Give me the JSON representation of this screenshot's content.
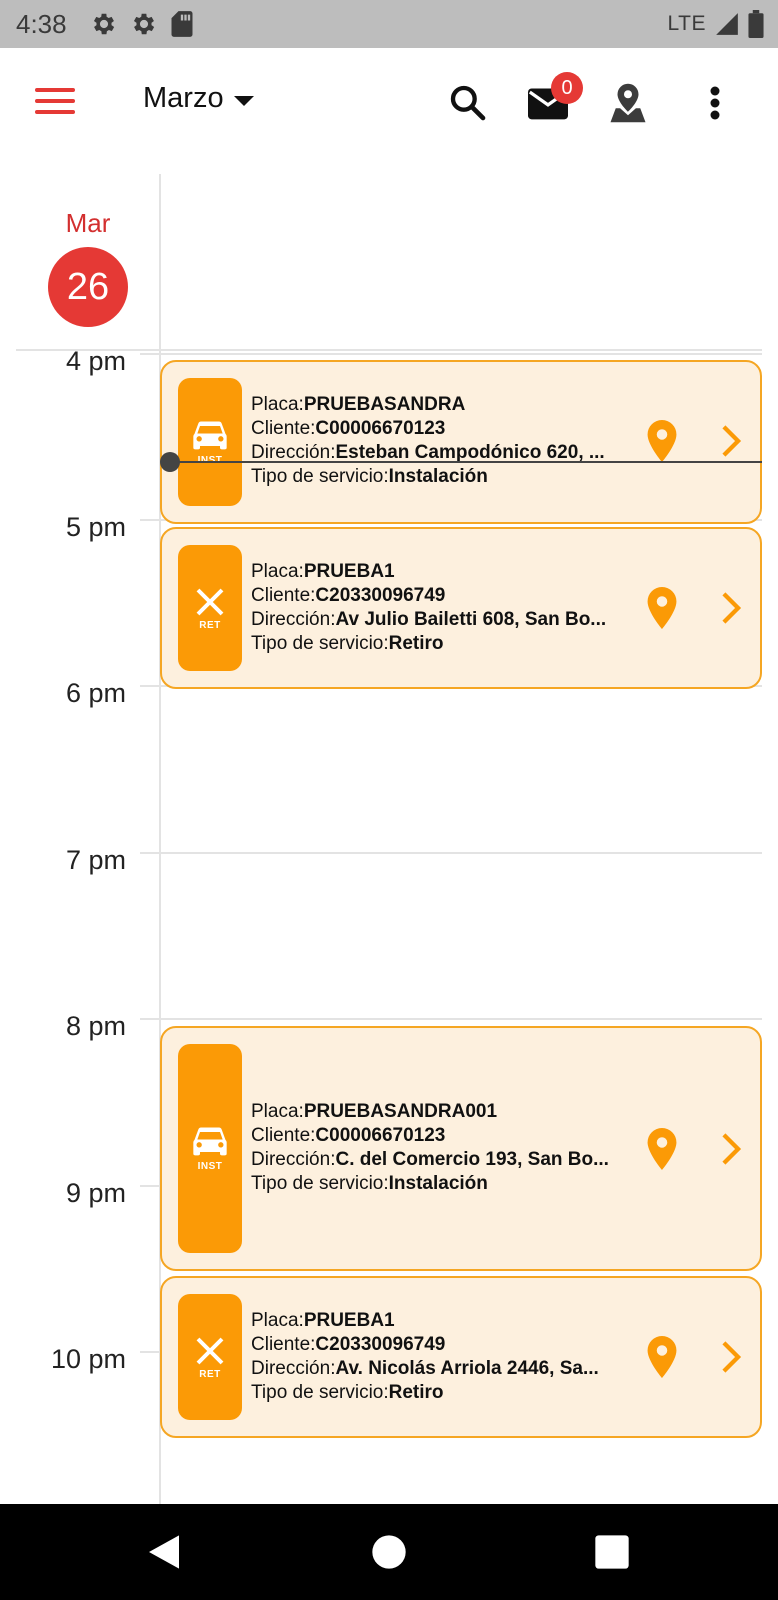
{
  "status_bar": {
    "time": "4:38",
    "network": "LTE",
    "left_icons": [
      "gear-icon",
      "gear-icon",
      "sd-card-icon"
    ],
    "right_icons": [
      "signal-icon",
      "battery-icon"
    ]
  },
  "app_bar": {
    "month": "Marzo",
    "mail_badge": "0",
    "icons": [
      "menu-icon",
      "search-icon",
      "mail-icon",
      "map-pin-icon",
      "more-vert-icon"
    ],
    "accent_color": "#e53935"
  },
  "day": {
    "weekday": "Mar",
    "number": "26"
  },
  "hours": [
    "4 pm",
    "5 pm",
    "6 pm",
    "7 pm",
    "8 pm",
    "9 pm",
    "10 pm"
  ],
  "labels": {
    "placa": "Placa:",
    "cliente": "Cliente:",
    "direccion": "Dirección:",
    "tipo": "Tipo de servicio:"
  },
  "events": [
    {
      "code": "INST",
      "icon": "car-icon",
      "placa": "PRUEBASANDRA",
      "cliente": "C00006670123",
      "direccion": "Esteban Campodónico 620, ...",
      "tipo": "Instalación"
    },
    {
      "code": "RET",
      "icon": "close-icon",
      "placa": "PRUEBA1",
      "cliente": "C20330096749",
      "direccion": "Av Julio Bailetti 608, San Bo...",
      "tipo": "Retiro"
    },
    {
      "code": "INST",
      "icon": "car-icon",
      "placa": "PRUEBASANDRA001",
      "cliente": "C00006670123",
      "direccion": "C. del Comercio 193, San Bo...",
      "tipo": "Instalación"
    },
    {
      "code": "RET",
      "icon": "close-icon",
      "placa": "PRUEBA1",
      "cliente": "C20330096749",
      "direccion": "Av. Nicolás Arriola 2446, Sa...",
      "tipo": "Retiro"
    }
  ],
  "colors": {
    "event_bg": "#fdf0de",
    "event_border": "#f5a623",
    "event_accent": "#fb9a06"
  },
  "nav_bar": {
    "icons": [
      "back-icon",
      "home-icon",
      "recents-icon"
    ]
  }
}
